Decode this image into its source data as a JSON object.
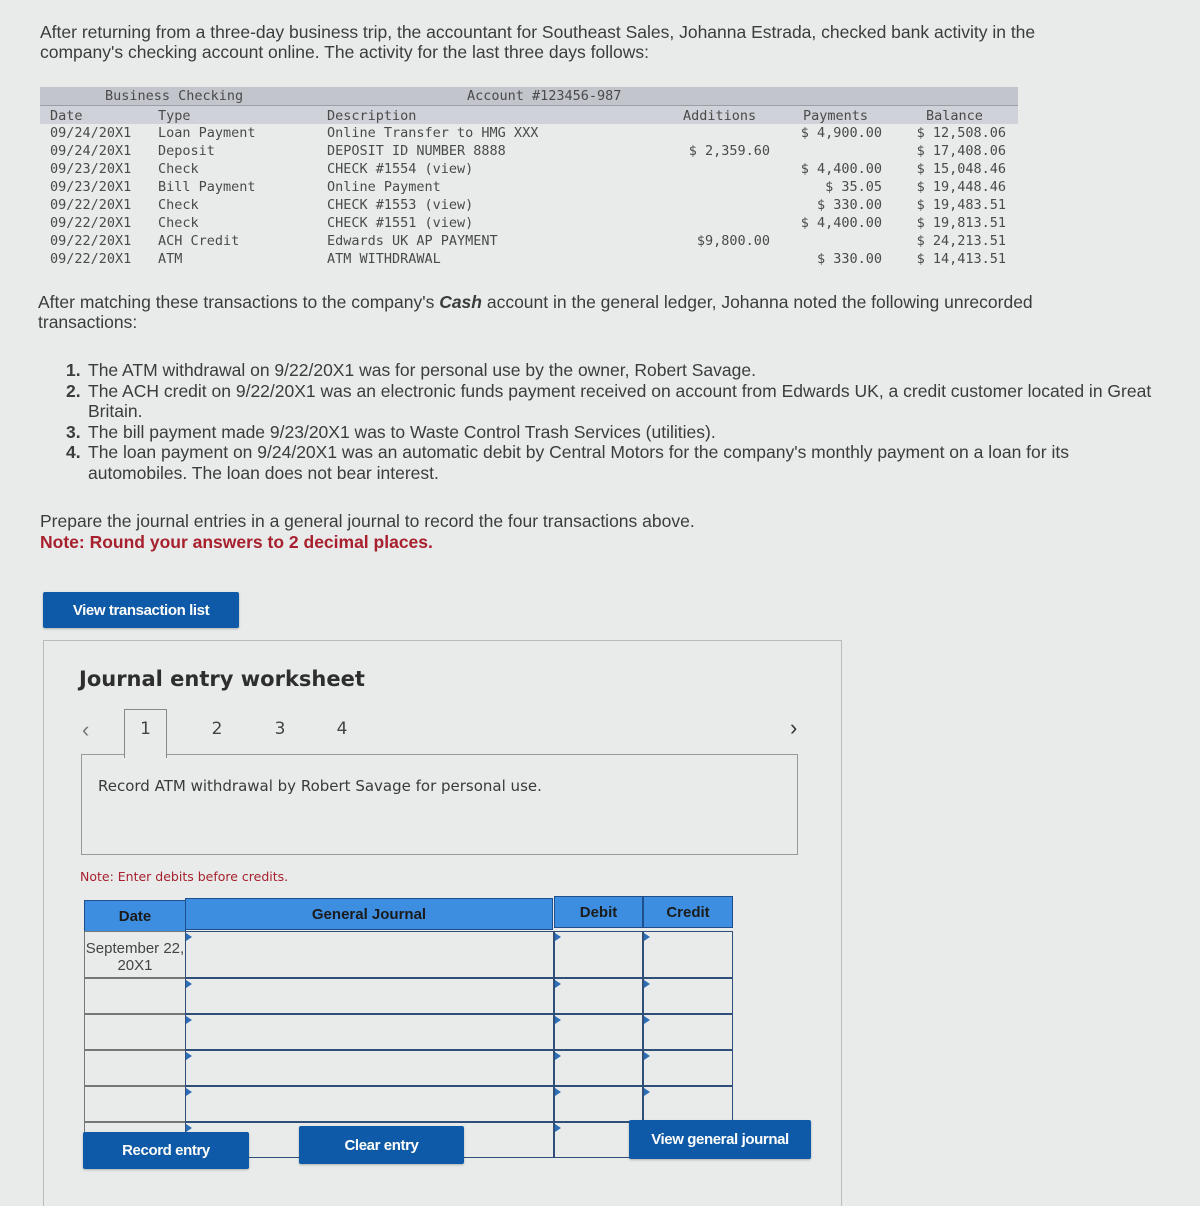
{
  "intro": "After returning from a three-day business trip, the accountant for Southeast Sales, Johanna Estrada, checked bank activity in the company's checking account online. The activity for the last three days follows:",
  "bank": {
    "title": "Business Checking",
    "account": "Account #123456-987",
    "headers": {
      "date": "Date",
      "type": "Type",
      "description": "Description",
      "additions": "Additions",
      "payments": "Payments",
      "balance": "Balance"
    },
    "rows": [
      {
        "date": "09/24/20X1",
        "type": "Loan Payment",
        "description": "Online Transfer to HMG XXX",
        "additions": "",
        "payments": "$ 4,900.00",
        "balance": "$ 12,508.06"
      },
      {
        "date": "09/24/20X1",
        "type": "Deposit",
        "description": "DEPOSIT ID NUMBER 8888",
        "additions": "$ 2,359.60",
        "payments": "",
        "balance": "$ 17,408.06"
      },
      {
        "date": "09/23/20X1",
        "type": "Check",
        "description": "CHECK #1554 (view)",
        "additions": "",
        "payments": "$ 4,400.00",
        "balance": "$ 15,048.46"
      },
      {
        "date": "09/23/20X1",
        "type": "Bill Payment",
        "description": "Online Payment",
        "additions": "",
        "payments": "$ 35.05",
        "balance": "$ 19,448.46"
      },
      {
        "date": "09/22/20X1",
        "type": "Check",
        "description": "CHECK #1553 (view)",
        "additions": "",
        "payments": "$ 330.00",
        "balance": "$ 19,483.51"
      },
      {
        "date": "09/22/20X1",
        "type": "Check",
        "description": "CHECK #1551 (view)",
        "additions": "",
        "payments": "$ 4,400.00",
        "balance": "$ 19,813.51"
      },
      {
        "date": "09/22/20X1",
        "type": "ACH Credit",
        "description": "Edwards UK AP PAYMENT",
        "additions": "$9,800.00",
        "payments": "",
        "balance": "$ 24,213.51"
      },
      {
        "date": "09/22/20X1",
        "type": "ATM",
        "description": "ATM WITHDRAWAL",
        "additions": "",
        "payments": "$ 330.00",
        "balance": "$ 14,413.51"
      }
    ]
  },
  "para2": {
    "before": "After matching these transactions to the company's ",
    "bold": "Cash",
    "after": " account in the general ledger, Johanna noted the following unrecorded transactions:"
  },
  "transactions": [
    {
      "num": "1.",
      "text": "The ATM withdrawal on 9/22/20X1 was for personal use by the owner, Robert Savage."
    },
    {
      "num": "2.",
      "text": "The ACH credit on 9/22/20X1 was an electronic funds payment received on account from Edwards UK, a credit customer located in Great Britain."
    },
    {
      "num": "3.",
      "text": "The bill payment made 9/23/20X1 was to Waste Control Trash Services (utilities)."
    },
    {
      "num": "4.",
      "text": "The loan payment on 9/24/20X1 was an automatic debit by Central Motors for the company's monthly payment on a loan for its automobiles. The loan does not bear interest."
    }
  ],
  "instructions": "Prepare the journal entries in a general journal to record the four transactions above.",
  "note": "Note: Round your answers to 2 decimal places.",
  "buttons": {
    "view_transactions": "View transaction list",
    "record": "Record entry",
    "clear": "Clear entry",
    "view_journal": "View general journal"
  },
  "worksheet": {
    "title": "Journal entry worksheet",
    "tabs": [
      "1",
      "2",
      "3",
      "4"
    ],
    "active_tab": "1",
    "prompt": "Record ATM withdrawal by Robert Savage for personal use.",
    "note": "Note: Enter debits before credits.",
    "table": {
      "headers": {
        "date": "Date",
        "journal": "General Journal",
        "debit": "Debit",
        "credit": "Credit"
      },
      "rows": [
        {
          "date": "September 22, 20X1",
          "account": "",
          "debit": "",
          "credit": ""
        },
        {
          "date": "",
          "account": "",
          "debit": "",
          "credit": ""
        },
        {
          "date": "",
          "account": "",
          "debit": "",
          "credit": ""
        },
        {
          "date": "",
          "account": "",
          "debit": "",
          "credit": ""
        },
        {
          "date": "",
          "account": "",
          "debit": "",
          "credit": ""
        },
        {
          "date": "",
          "account": "",
          "debit": "",
          "credit": ""
        }
      ]
    }
  },
  "colors": {
    "button_blue": "#0f5aa8",
    "header_blue": "#3d8ee0",
    "note_red": "#a8202e"
  }
}
